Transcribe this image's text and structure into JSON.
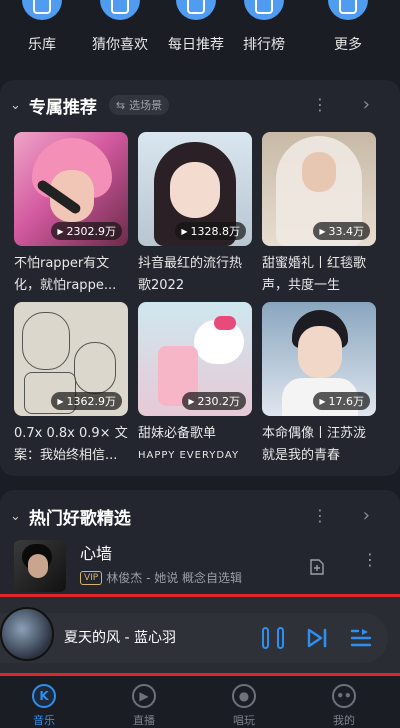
{
  "quick_nav": [
    {
      "label": "乐库",
      "icon": "music-library-icon"
    },
    {
      "label": "猜你喜欢",
      "icon": "guess-you-like-icon"
    },
    {
      "label": "每日推荐",
      "icon": "daily-recommend-icon"
    },
    {
      "label": "排行榜",
      "icon": "ranking-icon"
    },
    {
      "label": "更多",
      "icon": "more-icon"
    }
  ],
  "exclusive": {
    "title": "专属推荐",
    "scene_button": "选场景",
    "playlists": [
      {
        "title": "不怕rapper有文化，就怕rappe...",
        "play_count": "2302.9万"
      },
      {
        "title": "抖音最红的流行热歌2022",
        "play_count": "1328.8万"
      },
      {
        "title": "甜蜜婚礼丨红毯歌声，共度一生",
        "play_count": "33.4万"
      },
      {
        "title": "0.7x 0.8x 0.9× 文案：我始终相信...",
        "play_count": "1362.9万"
      },
      {
        "title": "甜妹必备歌单",
        "subtitle": "HAPPY EVERYDAY",
        "play_count": "230.2万"
      },
      {
        "title": "本命偶像丨汪苏泷就是我的青春",
        "play_count": "17.6万"
      }
    ]
  },
  "hot_songs": {
    "title": "热门好歌精选",
    "first_song": {
      "title": "心墙",
      "vip": "VIP",
      "meta": "林俊杰 - 她说 概念自选辑"
    }
  },
  "player": {
    "song": "夏天的风 - 蓝心羽",
    "accent": "#2f8ff0"
  },
  "bottom_nav": [
    {
      "label": "音乐",
      "active": true
    },
    {
      "label": "直播",
      "active": false
    },
    {
      "label": "唱玩",
      "active": false
    },
    {
      "label": "我的",
      "active": false
    }
  ],
  "colors": {
    "background": "#1b1d24",
    "card": "#23262e",
    "accent_blue": "#2f8ff0",
    "highlight_red": "#e0262a"
  }
}
